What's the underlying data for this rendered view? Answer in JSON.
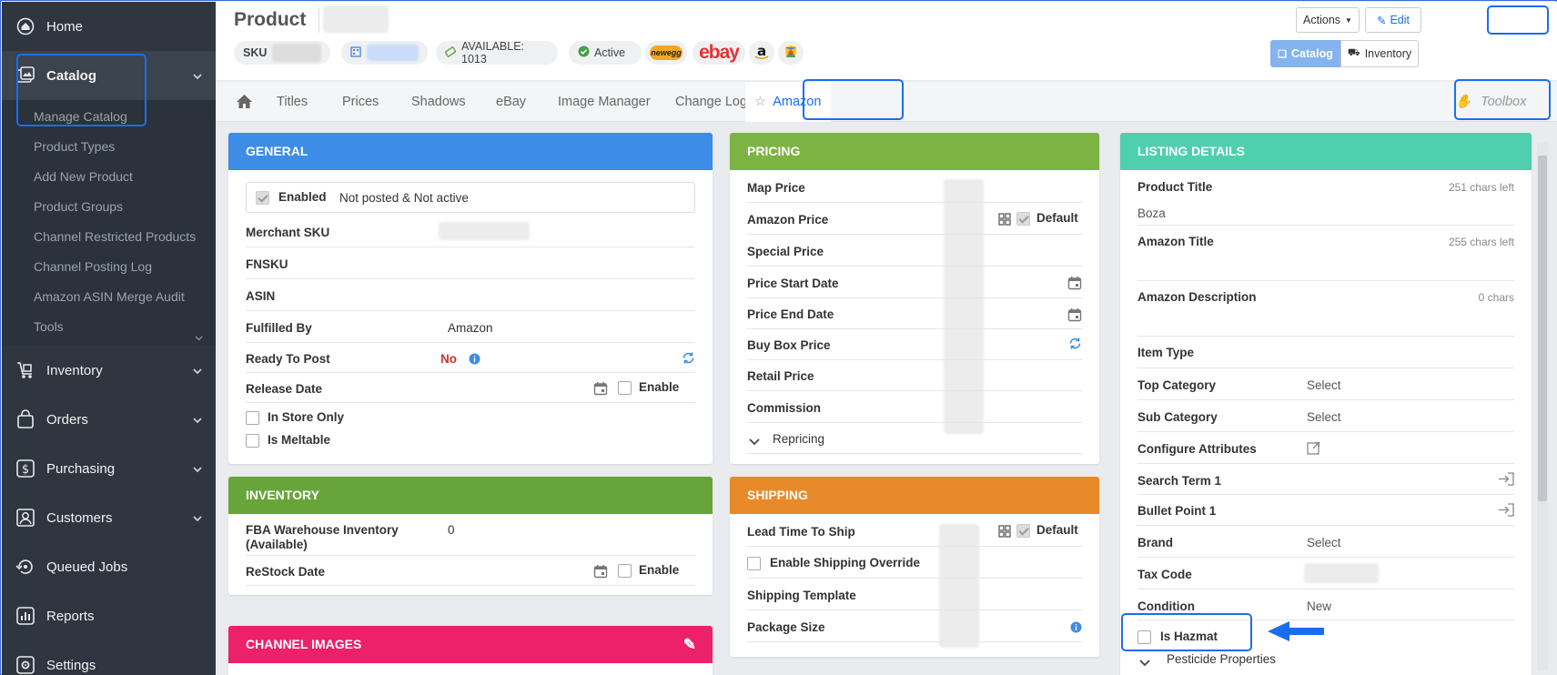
{
  "sidebar": {
    "items": [
      {
        "label": "Home",
        "icon": "home-icon"
      },
      {
        "label": "Catalog",
        "icon": "catalog-icon"
      },
      {
        "label": "Inventory",
        "icon": "inventory-icon"
      },
      {
        "label": "Orders",
        "icon": "orders-icon"
      },
      {
        "label": "Purchasing",
        "icon": "purchasing-icon"
      },
      {
        "label": "Customers",
        "icon": "customers-icon"
      },
      {
        "label": "Queued Jobs",
        "icon": "queued-jobs-icon"
      },
      {
        "label": "Reports",
        "icon": "reports-icon"
      },
      {
        "label": "Settings",
        "icon": "settings-icon"
      }
    ],
    "catalog_sub": [
      "Manage Catalog",
      "Product Types",
      "Add New Product",
      "Product Groups",
      "Channel Restricted Products",
      "Channel Posting Log",
      "Amazon ASIN Merge Audit",
      "Tools"
    ]
  },
  "header": {
    "title": "Product",
    "sku_label": "SKU",
    "available": "AVAILABLE: 1013",
    "status": "Active",
    "newegg": "newegg",
    "ebay": "ebay",
    "actions": "Actions",
    "edit": "Edit",
    "catalog": "Catalog",
    "inventory": "Inventory"
  },
  "tabs": [
    "Titles",
    "Prices",
    "Shadows",
    "eBay",
    "Image Manager",
    "Change Log",
    "Amazon"
  ],
  "toolbox": "Toolbox",
  "general": {
    "title": "GENERAL",
    "enabled": "Enabled",
    "enabled_status": "Not posted & Not active",
    "merchant_sku": "Merchant SKU",
    "fnsku": "FNSKU",
    "asin": "ASIN",
    "fulfilled_by": "Fulfilled By",
    "fulfilled_by_value": "Amazon",
    "ready_to_post": "Ready To Post",
    "ready_to_post_value": "No",
    "release_date": "Release Date",
    "enable": "Enable",
    "in_store_only": "In Store Only",
    "is_meltable": "Is Meltable"
  },
  "inventory": {
    "title": "INVENTORY",
    "fba": "FBA Warehouse Inventory (Available)",
    "fba_value": "0",
    "restock": "ReStock Date",
    "enable": "Enable"
  },
  "channel_images": {
    "title": "CHANNEL IMAGES"
  },
  "pricing": {
    "title": "PRICING",
    "rows": [
      "Map Price",
      "Amazon Price",
      "Special Price",
      "Price Start Date",
      "Price End Date",
      "Buy Box Price",
      "Retail Price",
      "Commission"
    ],
    "default": "Default",
    "repricing": "Repricing"
  },
  "shipping": {
    "title": "SHIPPING",
    "lead_time": "Lead Time To Ship",
    "default": "Default",
    "override": "Enable Shipping Override",
    "template": "Shipping Template",
    "package": "Package Size"
  },
  "listing": {
    "title": "LISTING DETAILS",
    "product_title": "Product Title",
    "product_title_left": "251 chars left",
    "product_title_value": "Boza",
    "amazon_title": "Amazon Title",
    "amazon_title_left": "255 chars left",
    "amazon_desc": "Amazon Description",
    "amazon_desc_chars": "0 chars",
    "item_type": "Item Type",
    "top_category": "Top Category",
    "sub_category": "Sub Category",
    "select": "Select",
    "configure": "Configure Attributes",
    "search_term": "Search Term 1",
    "bullet_point": "Bullet Point 1",
    "brand": "Brand",
    "tax_code": "Tax Code",
    "condition": "Condition",
    "condition_value": "New",
    "is_hazmat": "Is Hazmat",
    "pesticide": "Pesticide Properties"
  },
  "colors": {
    "general": "#3d8ce6",
    "pricing": "#7cb342",
    "inventory": "#67a53a",
    "shipping": "#e88a2a",
    "listing": "#4fcfae",
    "channel_images": "#ec2169",
    "highlight": "#1a6df2"
  }
}
